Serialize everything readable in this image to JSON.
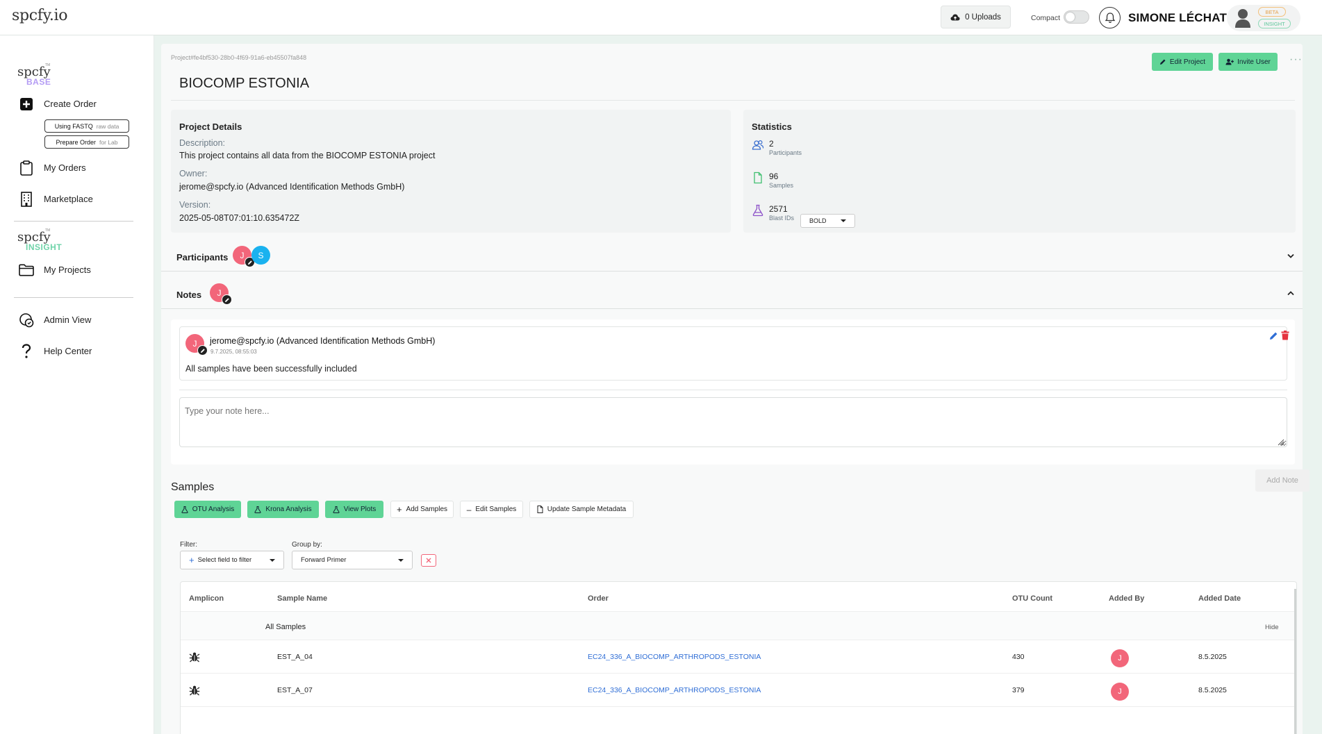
{
  "app": {
    "logo": "spcfy.io"
  },
  "header": {
    "uploads_label": "0 Uploads",
    "compact_label": "Compact",
    "user_name": "SIMONE LÉCHAT",
    "badge_beta": "BETA",
    "badge_insight": "INSIGHT"
  },
  "sidebar": {
    "base_brand": "spcfy",
    "base_sub": "BASE",
    "create_order": "Create Order",
    "using_fastq": "Using FASTQ",
    "using_fastq_hint": "raw data",
    "prepare_order": "Prepare Order",
    "prepare_order_hint": "for Lab",
    "my_orders": "My Orders",
    "marketplace": "Marketplace",
    "insight_brand": "spcfy",
    "insight_sub": "INSIGHT",
    "my_projects": "My Projects",
    "admin_view": "Admin View",
    "help_center": "Help Center"
  },
  "project": {
    "id": "Project#fe4bf530-28b0-4f69-91a6-eb45507fa848",
    "title": "BIOCOMP ESTONIA",
    "edit_label": "Edit Project",
    "invite_label": "Invite User",
    "more": "···"
  },
  "details": {
    "heading": "Project Details",
    "description_label": "Description:",
    "description": "This project contains all data from the BIOCOMP ESTONIA project",
    "owner_label": "Owner:",
    "owner": "jerome@spcfy.io (Advanced Identification Methods GmbH)",
    "version_label": "Version:",
    "version": "2025-05-08T07:01:10.635472Z"
  },
  "statistics": {
    "heading": "Statistics",
    "participants_value": "2",
    "participants_label": "Participants",
    "samples_value": "96",
    "samples_label": "Samples",
    "blast_value": "2571",
    "blast_label": "Blast IDs",
    "db_selected": "BOLD"
  },
  "participants": {
    "heading": "Participants",
    "members": [
      {
        "initial": "J"
      },
      {
        "initial": "S"
      }
    ]
  },
  "notes": {
    "heading": "Notes",
    "author_initial": "J",
    "items": [
      {
        "initial": "J",
        "author": "jerome@spcfy.io (Advanced Identification Methods GmbH)",
        "date": "9.7.2025, 08:55:03",
        "text": "All samples have been successfully included"
      }
    ],
    "input_placeholder": "Type your note here...",
    "add_button": "Add Note"
  },
  "samples": {
    "heading": "Samples",
    "toolbar": {
      "otu": "OTU Analysis",
      "krona": "Krona Analysis",
      "plots": "View Plots",
      "add": "Add Samples",
      "edit": "Edit Samples",
      "update_meta": "Update Sample Metadata"
    },
    "filter_label": "Filter:",
    "filter_placeholder": "Select field to filter",
    "group_label": "Group by:",
    "group_value": "Forward Primer",
    "columns": {
      "amplicon": "Amplicon",
      "sample_name": "Sample Name",
      "order": "Order",
      "otu_count": "OTU Count",
      "added_by": "Added By",
      "added_date": "Added Date"
    },
    "group_row": {
      "label": "All Samples",
      "hide": "Hide"
    },
    "rows": [
      {
        "sample_name": "EST_A_04",
        "order": "EC24_336_A_BIOCOMP_ARTHROPODS_ESTONIA",
        "otu_count": "430",
        "added_by": "J",
        "added_date": "8.5.2025"
      },
      {
        "sample_name": "EST_A_07",
        "order": "EC24_336_A_BIOCOMP_ARTHROPODS_ESTONIA",
        "otu_count": "379",
        "added_by": "J",
        "added_date": "8.5.2025"
      }
    ]
  },
  "colors": {
    "accent_green": "#5fd496",
    "avatar_pink": "#f2667a",
    "avatar_blue": "#1ab2ef",
    "link_blue": "#2f6ed6",
    "base_purple": "#b49cf4",
    "insight_green": "#6fd3a9"
  }
}
